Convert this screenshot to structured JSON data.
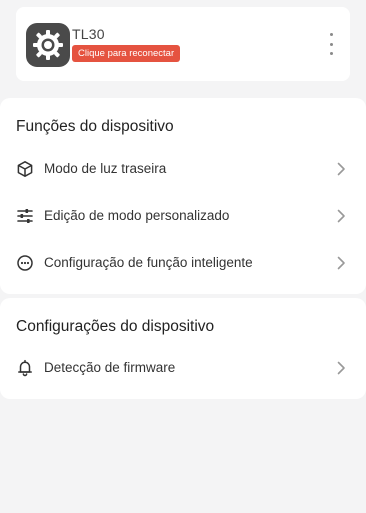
{
  "device": {
    "name": "TL30",
    "status_badge": "Clique para reconectar",
    "badge_color": "#e55340",
    "avatar_icon": "gear-icon"
  },
  "device_functions": {
    "title": "Funções do dispositivo",
    "items": [
      {
        "label": "Modo de luz traseira",
        "icon": "cube-icon"
      },
      {
        "label": "Edição de modo personalizado",
        "icon": "sliders-icon"
      },
      {
        "label": "Configuração de função inteligente",
        "icon": "dots-circle-icon"
      }
    ]
  },
  "device_settings": {
    "title": "Configurações do dispositivo",
    "items": [
      {
        "label": "Detecção de firmware",
        "icon": "bell-icon"
      }
    ]
  }
}
